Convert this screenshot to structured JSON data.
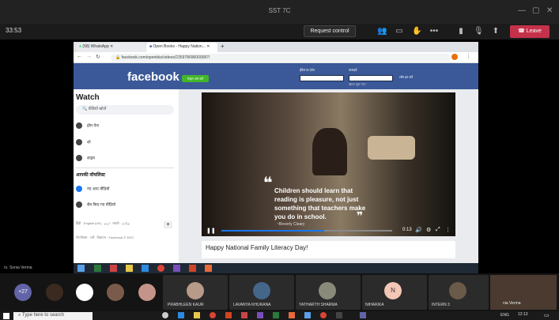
{
  "teams": {
    "window_title": "SST 7C",
    "timer": "33:53",
    "request_control": "Request control",
    "leave": "Leave"
  },
  "browser": {
    "tabs": [
      "(58) WhatsApp",
      "Open Books - Happy Nation..."
    ],
    "url": "facebook.com/openbks/videos/235978696000087/"
  },
  "facebook": {
    "logo": "facebook",
    "signup": "साइन अप करें",
    "email_label": "ईमेल या फ़ोन",
    "password_label": "पासवर्ड",
    "login": "लॉग इन करें",
    "forgot": "खाता भूल गए?",
    "watch_title": "Watch",
    "search_placeholder": "वीडियो खोजें",
    "nav": [
      "होम पेज",
      "शो",
      "लाइव"
    ],
    "saved_header": "आपकी वॉचलिस्ट",
    "saved": [
      "नए आए वीडियो",
      "सेव किए गए वीडियो"
    ],
    "footer1": "हिंदी · English (UK) · اردو · मराठी · தமிழ்",
    "footer2": "गोपनीयता · शर्तें · विज्ञापन · Facebook © 2021"
  },
  "video": {
    "quote": "Children should learn that reading is pleasure, not just something that teachers make you do in school.",
    "author": "~Beverly Cleary",
    "time": "0:13",
    "progress": 0.6,
    "caption": "Happy National Family Literacy Day!"
  },
  "meeting": {
    "presenter": "rs. Sonia Verma",
    "more_count": "+27",
    "participants": [
      {
        "name": "PRABHLEEN KAUR",
        "color": "#b89a88"
      },
      {
        "name": "LAVANYA KHURANA",
        "color": "#446688"
      },
      {
        "name": "YATHARTH SHARMA",
        "color": "#8a8a7a"
      },
      {
        "name": "NIHARIKA",
        "initial": "N",
        "color": "#f3c6b6"
      },
      {
        "name": "INTERN 3",
        "color": "#6a5a4a"
      }
    ],
    "self_name": "nia Verma"
  },
  "windows": {
    "search": "Type here to search",
    "tray_lang": "ENG",
    "clock": "12:13"
  }
}
